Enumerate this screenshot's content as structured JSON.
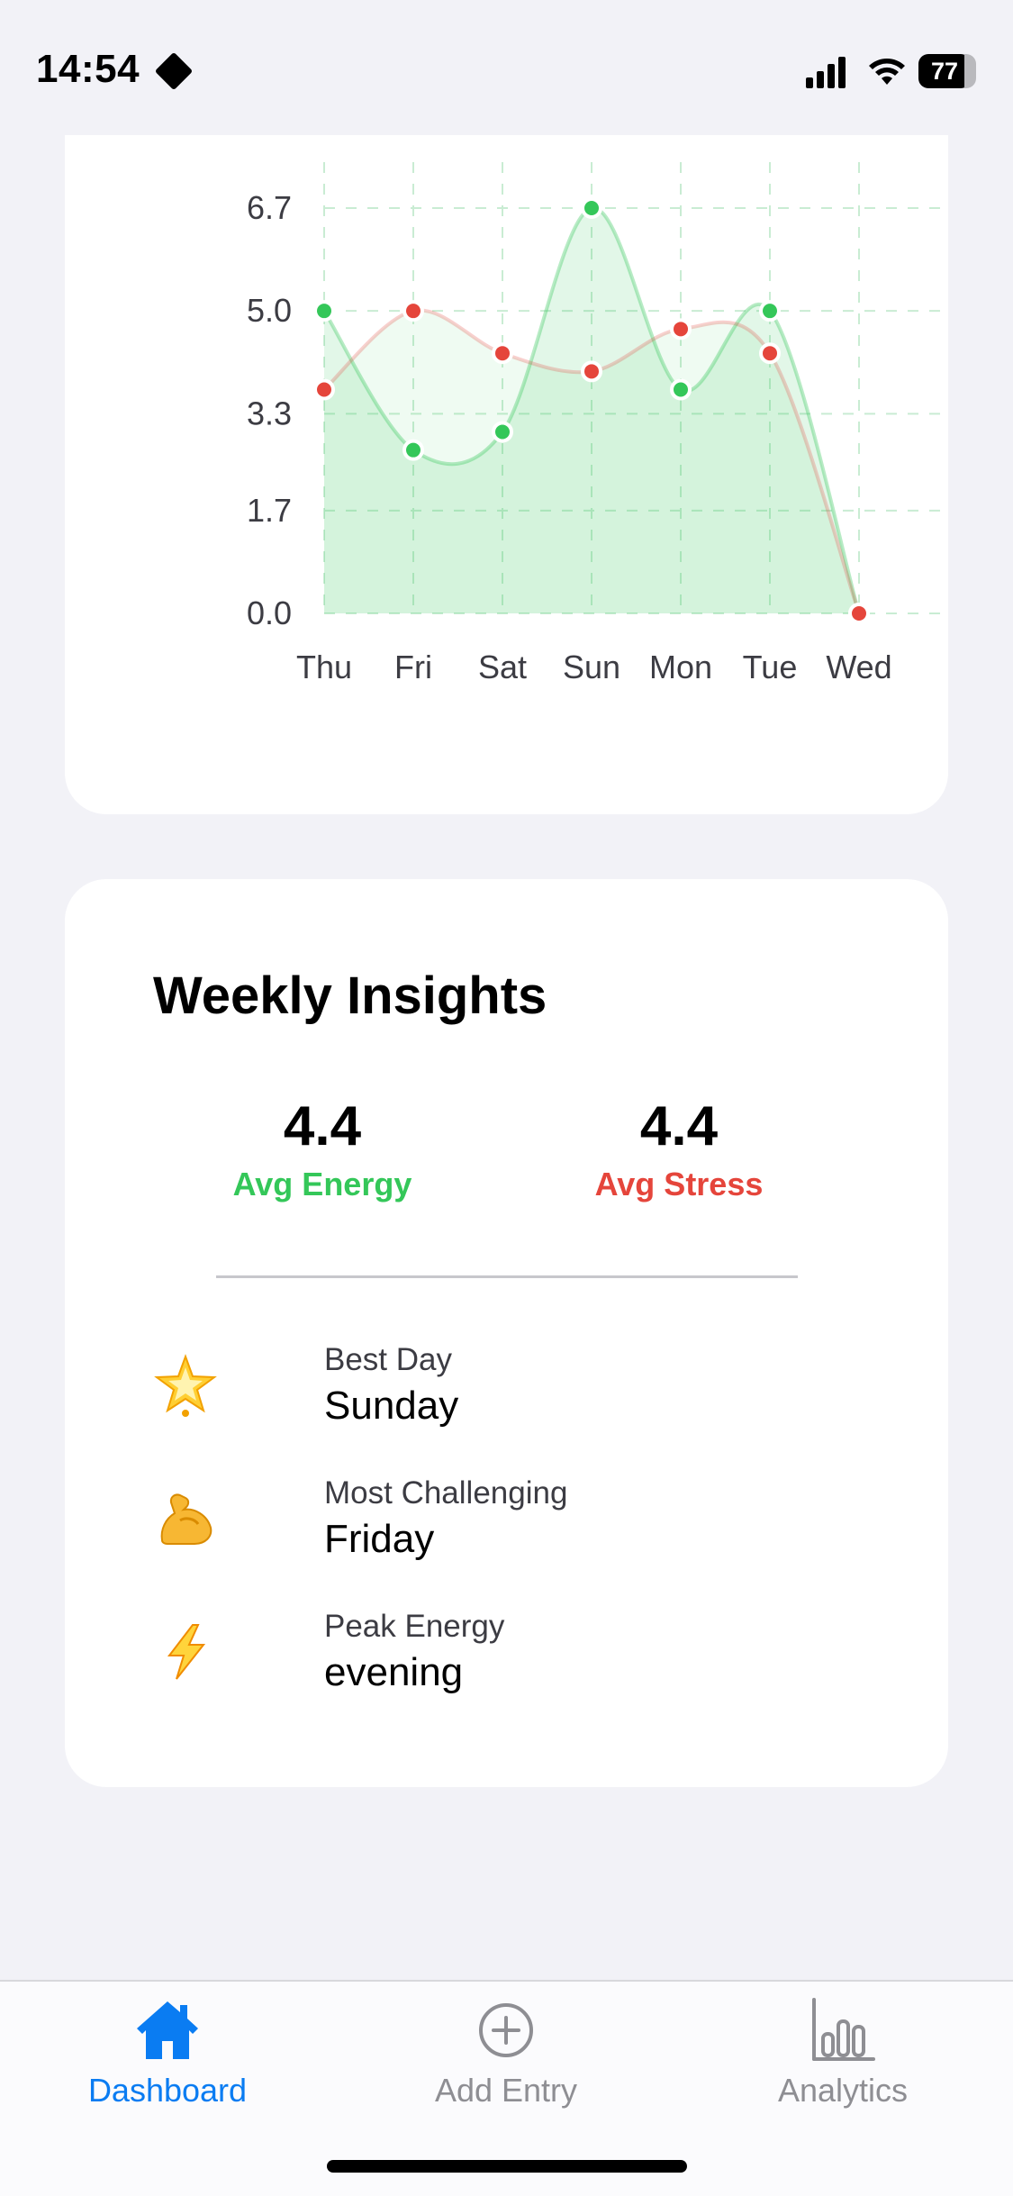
{
  "status_bar": {
    "time": "14:54",
    "battery": "77",
    "battery_level": 0.77
  },
  "chart_data": {
    "type": "area",
    "categories": [
      "Thu",
      "Fri",
      "Sat",
      "Sun",
      "Mon",
      "Tue",
      "Wed"
    ],
    "yticks": [
      "0.0",
      "1.7",
      "3.3",
      "5.0",
      "6.7"
    ],
    "ylim": [
      0,
      6.7
    ],
    "grid": true,
    "series": [
      {
        "values": [
          5.0,
          2.7,
          3.0,
          6.7,
          3.7,
          5.0,
          0.0
        ],
        "color": "#34c759"
      },
      {
        "values": [
          3.7,
          5.0,
          4.3,
          4.0,
          4.7,
          4.3,
          0.0
        ],
        "color": "#e5453b"
      }
    ]
  },
  "insights": {
    "title": "Weekly Insights",
    "avg_energy": {
      "value": "4.4",
      "label": "Avg Energy"
    },
    "avg_stress": {
      "value": "4.4",
      "label": "Avg Stress"
    },
    "rows": [
      {
        "icon": "glowing-star-icon",
        "label": "Best Day",
        "value": "Sunday"
      },
      {
        "icon": "flexed-biceps-icon",
        "label": "Most Challenging",
        "value": "Friday"
      },
      {
        "icon": "lightning-icon",
        "label": "Peak Energy",
        "value": "evening"
      }
    ]
  },
  "tab_bar": {
    "active": "Dashboard",
    "active_color": "#0a7cf2",
    "tabs": [
      {
        "label": "Dashboard",
        "icon": "house-icon"
      },
      {
        "label": "Add Entry",
        "icon": "plus-circle-icon"
      },
      {
        "label": "Analytics",
        "icon": "bar-chart-icon"
      }
    ]
  }
}
